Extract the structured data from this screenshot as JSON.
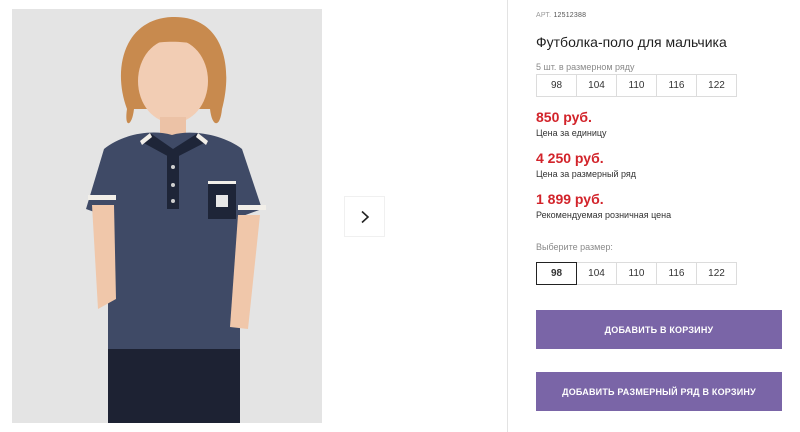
{
  "gallery": {
    "photo_alt": "Boy wearing a navy polo shirt",
    "next_icon": "chevron-right-icon"
  },
  "product": {
    "art_label": "АРТ.",
    "art_number": "12512388",
    "title": "Футболка-поло для мальчика",
    "pack_caption": "5 шт. в размерном ряду",
    "pack_sizes": [
      "98",
      "104",
      "110",
      "116",
      "122"
    ],
    "prices": [
      {
        "value": "850 руб.",
        "label": "Цена за единицу"
      },
      {
        "value": "4 250 руб.",
        "label": "Цена за размерный ряд"
      },
      {
        "value": "1 899 руб.",
        "label": "Рекомендуемая розничная цена"
      }
    ],
    "choose_size_caption": "Выберите размер:",
    "sizes": [
      "98",
      "104",
      "110",
      "116",
      "122"
    ],
    "selected_size": "98"
  },
  "actions": {
    "add_to_cart": "ДОБАВИТЬ В КОРЗИНУ",
    "add_pack_to_cart": "ДОБАВИТЬ РАЗМЕРНЫЙ РЯД В КОРЗИНУ"
  },
  "colors": {
    "accent": "#7a65a7",
    "price": "#d2232a"
  }
}
